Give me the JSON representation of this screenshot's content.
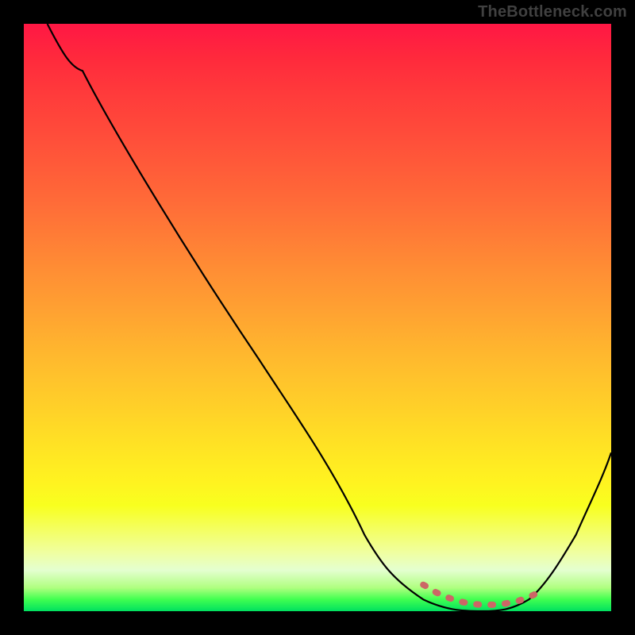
{
  "watermark": "TheBottleneck.com",
  "chart_data": {
    "type": "line",
    "title": "",
    "xlabel": "",
    "ylabel": "",
    "xlim": [
      0,
      100
    ],
    "ylim": [
      0,
      100
    ],
    "grid": false,
    "series": [
      {
        "name": "bottleneck-curve",
        "color": "#000000",
        "x": [
          4,
          10,
          20,
          30,
          40,
          50,
          58,
          63,
          68,
          73,
          78,
          82,
          86,
          90,
          94,
          100
        ],
        "values": [
          100,
          92,
          78,
          63,
          48,
          33,
          21,
          13,
          6,
          2,
          0,
          0,
          2,
          6,
          13,
          27
        ]
      },
      {
        "name": "optimal-range-marker",
        "color": "#cc6666",
        "x": [
          68,
          70,
          72,
          74,
          76,
          78,
          80,
          82,
          84,
          86,
          88
        ],
        "values": [
          4.5,
          3.3,
          2.4,
          1.7,
          1.3,
          1.1,
          1.1,
          1.3,
          1.7,
          2.4,
          3.3
        ]
      }
    ],
    "gradient_stops": [
      {
        "pos": 0.0,
        "color": "#ff1744"
      },
      {
        "pos": 0.5,
        "color": "#ffa030"
      },
      {
        "pos": 0.8,
        "color": "#fff320"
      },
      {
        "pos": 0.95,
        "color": "#c0ff80"
      },
      {
        "pos": 1.0,
        "color": "#00e060"
      }
    ],
    "annotations": []
  }
}
